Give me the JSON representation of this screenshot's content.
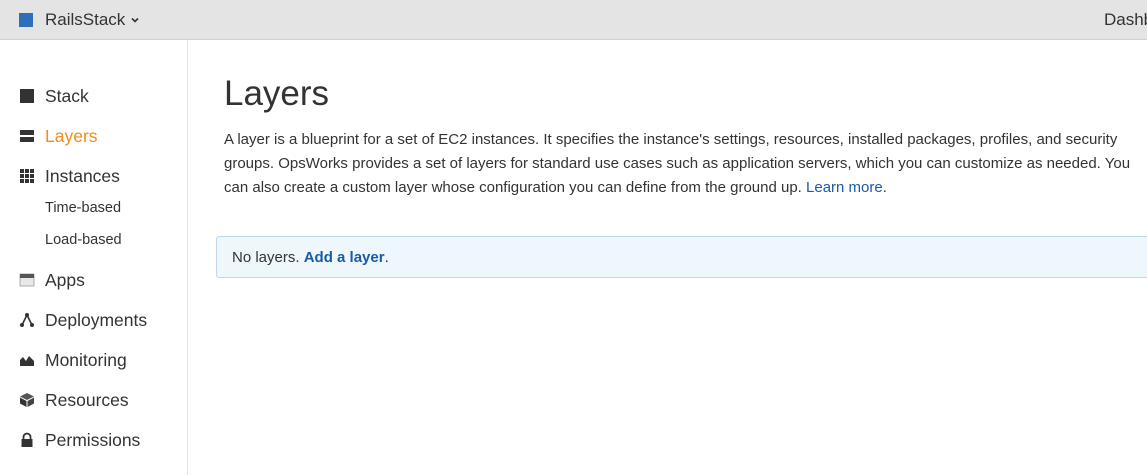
{
  "topbar": {
    "stack_name": "RailsStack",
    "stack_icon": "square-icon",
    "dropdown_icon": "chevron-down-icon",
    "right_link": "Dashboard"
  },
  "sidebar": {
    "items": [
      {
        "label": "Stack",
        "icon": "stack-icon"
      },
      {
        "label": "Layers",
        "icon": "layers-icon",
        "active": true
      },
      {
        "label": "Instances",
        "icon": "grid-icon"
      },
      {
        "label": "Time-based"
      },
      {
        "label": "Load-based"
      },
      {
        "label": "Apps",
        "icon": "apps-icon"
      },
      {
        "label": "Deployments",
        "icon": "deployments-icon"
      },
      {
        "label": "Monitoring",
        "icon": "monitoring-icon"
      },
      {
        "label": "Resources",
        "icon": "cube-icon"
      },
      {
        "label": "Permissions",
        "icon": "lock-icon"
      }
    ]
  },
  "main": {
    "title": "Layers",
    "description": "A layer is a blueprint for a set of EC2 instances. It specifies the instance's settings, resources, installed packages, profiles, and security groups. OpsWorks provides a set of layers for standard use cases such as application servers, which you can customize as needed. You can also create a custom layer whose configuration you can define from the ground up.",
    "learn_more": "Learn more",
    "notice_text": "No layers.",
    "notice_link": "Add a layer"
  },
  "colors": {
    "accent": "#f08c1c",
    "link": "#1a5ba8",
    "stack_square": "#2e6fb7",
    "notice_bg": "#eef7fc"
  }
}
